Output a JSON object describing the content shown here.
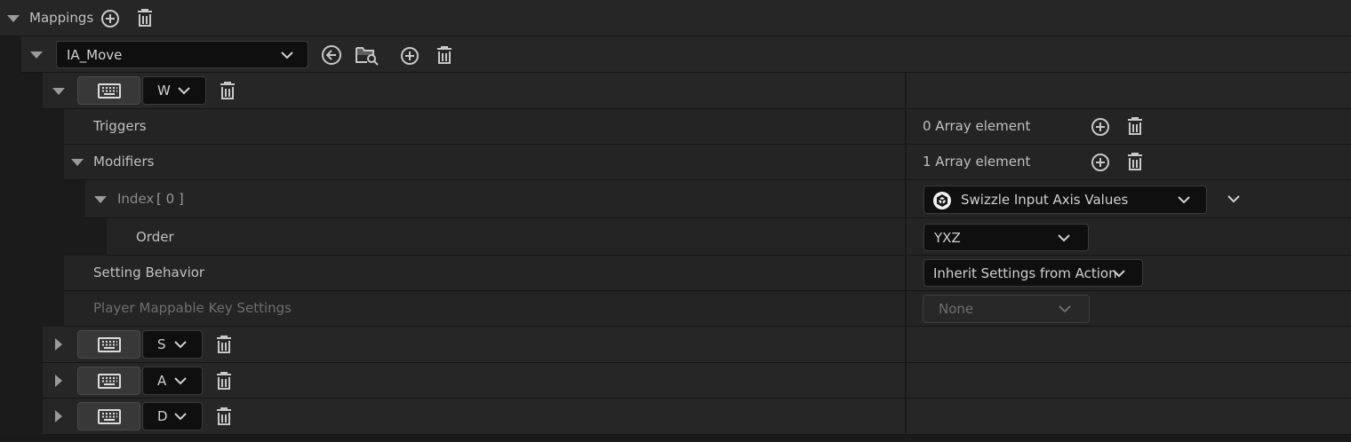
{
  "mappings": {
    "label": "Mappings",
    "add_icon": "plus-circle-icon",
    "delete_icon": "trash-icon"
  },
  "action": {
    "selected": "IA_Move",
    "back_icon": "back-arrow-circle-icon",
    "browse_icon": "folder-search-icon",
    "add_icon": "plus-circle-icon",
    "delete_icon": "trash-icon"
  },
  "key_w": {
    "key": "W",
    "device_icon": "keyboard-icon",
    "triggers": {
      "label": "Triggers",
      "value": "0 Array element"
    },
    "modifiers": {
      "label": "Modifiers",
      "value": "1 Array element",
      "index": {
        "label": "Index",
        "number": "[ 0 ]",
        "selected": "Swizzle Input Axis Values",
        "order_label": "Order",
        "order_value": "YXZ"
      }
    },
    "setting_behavior": {
      "label": "Setting Behavior",
      "value": "Inherit Settings from Action"
    },
    "player_mappable": {
      "label": "Player Mappable Key Settings",
      "value": "None"
    }
  },
  "keys_collapsed": [
    {
      "key": "S"
    },
    {
      "key": "A"
    },
    {
      "key": "D"
    }
  ]
}
